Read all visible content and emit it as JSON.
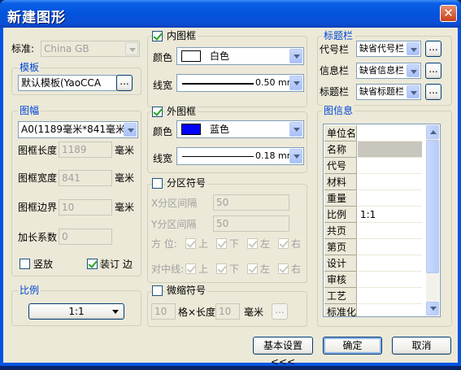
{
  "window": {
    "title": "新建图形",
    "close_glyph": "✕"
  },
  "standard": {
    "label": "标准:",
    "value": "China GB"
  },
  "template": {
    "group_label": "模板",
    "value": "默认模板(YaoCCA",
    "browse": "..."
  },
  "paper": {
    "group_label": "图幅",
    "size_value": "A0(1189毫米*841毫米)",
    "length_label": "图框长度",
    "length_value": "1189",
    "width_label": "图框宽度",
    "width_value": "841",
    "border_label": "图框边界",
    "border_value": "10",
    "unit": "毫米",
    "extend_label": "加长系数",
    "extend_value": "0",
    "portrait_label": "竖放",
    "binding_label": "装订 边"
  },
  "scale": {
    "group_label": "比例",
    "value": "1:1"
  },
  "inner_frame": {
    "label": "内图框",
    "color_label": "颜色",
    "color_value": "白色",
    "color_hex": "#ffffff",
    "width_label": "线宽",
    "width_value": "0.50 mm"
  },
  "outer_frame": {
    "label": "外图框",
    "color_label": "颜色",
    "color_value": "蓝色",
    "color_hex": "#0000ff",
    "width_label": "线宽",
    "width_value": "0.18 mm"
  },
  "zone": {
    "label": "分区符号",
    "x_label": "X分区间隔",
    "x_value": "50",
    "y_label": "Y分区间隔",
    "y_value": "50",
    "dir_label": "方  位:",
    "center_label": "对中线:",
    "opts": [
      "上",
      "下",
      "左",
      "右"
    ]
  },
  "micro": {
    "label": "微缩符号",
    "grid_value": "10",
    "grid_label": "格×长度",
    "len_value": "10",
    "unit": "毫米",
    "browse": "..."
  },
  "titleblock": {
    "group_label": "标题栏",
    "rows": [
      {
        "label": "代号栏",
        "value": "缺省代号栏"
      },
      {
        "label": "信息栏",
        "value": "缺省信息栏"
      },
      {
        "label": "标题栏",
        "value": "缺省标题栏"
      }
    ],
    "browse": "..."
  },
  "info": {
    "group_label": "图信息",
    "rows": [
      {
        "key": "单位名",
        "value": ""
      },
      {
        "key": "名称",
        "value": ""
      },
      {
        "key": "代号",
        "value": ""
      },
      {
        "key": "材料",
        "value": ""
      },
      {
        "key": "重量",
        "value": ""
      },
      {
        "key": "比例",
        "value": "1:1"
      },
      {
        "key": "共页",
        "value": ""
      },
      {
        "key": "第页",
        "value": ""
      },
      {
        "key": "设计",
        "value": ""
      },
      {
        "key": "审核",
        "value": ""
      },
      {
        "key": "工艺",
        "value": ""
      },
      {
        "key": "标准化",
        "value": ""
      }
    ]
  },
  "buttons": {
    "basic": "基本设置<<<",
    "ok": "确定",
    "cancel": "取消"
  }
}
